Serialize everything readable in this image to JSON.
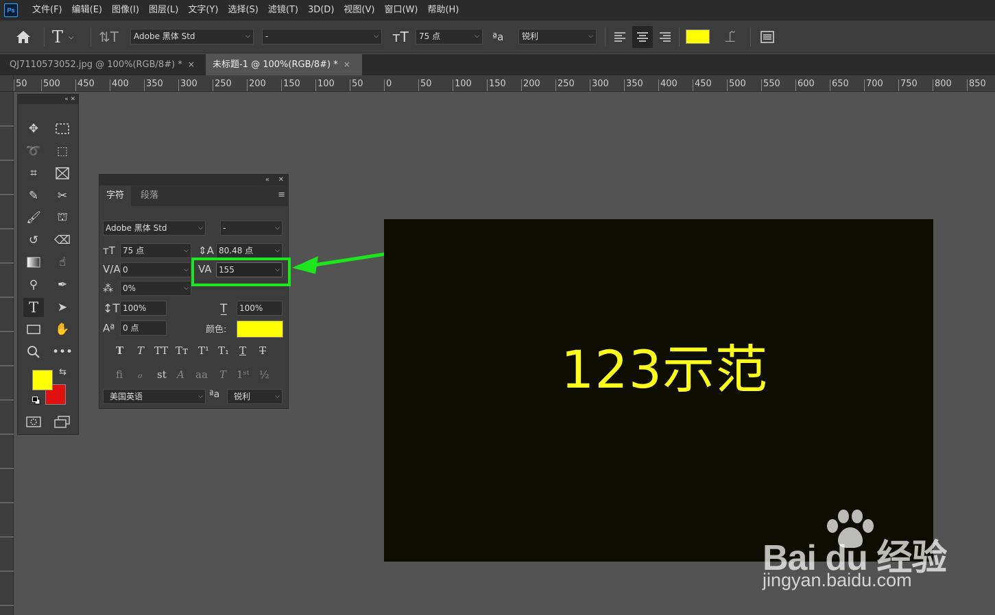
{
  "menu": {
    "logo": "Ps",
    "items": [
      "文件(F)",
      "编辑(E)",
      "图像(I)",
      "图层(L)",
      "文字(Y)",
      "选择(S)",
      "滤镜(T)",
      "3D(D)",
      "视图(V)",
      "窗口(W)",
      "帮助(H)"
    ]
  },
  "options": {
    "font_family": "Adobe 黑体 Std",
    "font_style": "-",
    "font_size": "75 点",
    "antialias": "锐利",
    "color": "#ffff00"
  },
  "tabs": [
    {
      "label": "QJ7110573052.jpg @ 100%(RGB/8#) *",
      "close": "×"
    },
    {
      "label": "未标题-1 @ 100%(RGB/8#) *",
      "close": "×"
    }
  ],
  "ruler": {
    "h_labels": [
      "50",
      "500",
      "450",
      "400",
      "350",
      "300",
      "250",
      "200",
      "150",
      "100",
      "50",
      "0",
      "50",
      "100",
      "150",
      "200",
      "250",
      "300",
      "350",
      "400",
      "450",
      "500",
      "550",
      "600",
      "650",
      "700",
      "750",
      "800",
      "850"
    ]
  },
  "colors": {
    "foreground": "#ffff00",
    "background": "#e01010"
  },
  "panel": {
    "tabs": [
      "字符",
      "段落"
    ],
    "font_family": "Adobe 黑体 Std",
    "font_style": "-",
    "font_size": "75 点",
    "leading": "80.48 点",
    "kerning": "0",
    "tracking": "155",
    "tsume": "0%",
    "vertical_scale": "100%",
    "horizontal_scale": "100%",
    "baseline_shift": "0 点",
    "color_label": "颜色:",
    "language": "美国英语",
    "antialias": "锐利"
  },
  "canvas": {
    "text": "123示范"
  },
  "watermark": {
    "brand": "Bai  du 经验",
    "url": "jingyan.baidu.com"
  }
}
